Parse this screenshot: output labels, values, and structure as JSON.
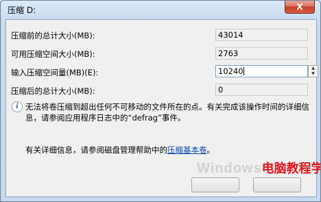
{
  "window": {
    "title": "压缩 D:",
    "close_glyph": "X"
  },
  "rows": {
    "total_before": {
      "label": "压缩前的总计大小(MB):",
      "value": "43014"
    },
    "available": {
      "label": "可用压缩空间大小(MB):",
      "value": "2763"
    },
    "amount": {
      "label": "输入压缩空间量(MB)(E):",
      "value": "10240"
    },
    "total_after": {
      "label": "压缩后的总计大小(MB):",
      "value": "0"
    }
  },
  "info": {
    "icon": "info-icon",
    "text": "无法将卷压缩到超出任何不可移动的文件所在的点。有关完成该操作时间的详细信息，请参阅应用程序日志中的“defrag”事件。"
  },
  "more_info": {
    "prefix": "有关详细信息，请参阅磁盘管理帮助中的",
    "link": "压缩基本卷",
    "suffix": "。"
  },
  "watermark": {
    "latin": "Windows",
    "cn": "电脑教程学习网"
  }
}
